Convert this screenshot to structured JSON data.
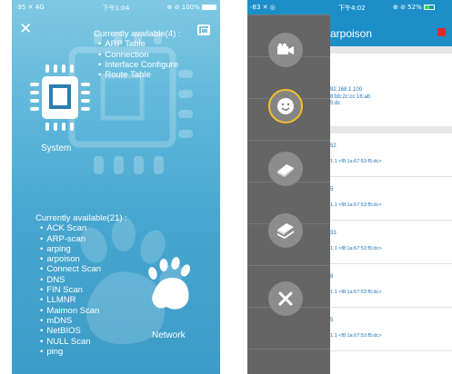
{
  "left_phone": {
    "status_bar": {
      "signal": "-95 ✕ 4G",
      "time": "下午1:04",
      "right": "⊕ ⊘ 100%"
    },
    "close_icon": "close-icon",
    "tab_icon": "window-icon",
    "system": {
      "label": "System",
      "header": "Currently available(4) :",
      "items": [
        "ARP Table",
        "Connection",
        "Interface Configure",
        "Route Table"
      ]
    },
    "network": {
      "label": "Network",
      "header": "Currently available(21) :",
      "items": [
        "ACK Scan",
        "ARP-scan",
        "arping",
        "arpoison",
        "Connect Scan",
        "DNS",
        "FIN Scan",
        "LLMNR",
        "Maimon Scan",
        "mDNS",
        "NetBIOS",
        "NULL Scan",
        "ping"
      ]
    }
  },
  "right_phone": {
    "status_bar": {
      "signal": "-83 ✕ ◎",
      "time": "下午4:02",
      "right": "⊕ ⊘ 52%"
    },
    "title": "arpoison",
    "info_lines": [
      "92.168.1.100",
      "8:bb:2c:cc:16:ab",
      "5:dc"
    ],
    "rows": [
      {
        "a": "52",
        "b": "1.1 <f8:1a:67:53:f5:dc>"
      },
      {
        "a": "5",
        "b": "1.1 <f8:1a:67:53:f5:dc>"
      },
      {
        "a": "33",
        "b": "1.1 <f8:1a:67:53:f5:dc>"
      },
      {
        "a": "8",
        "b": "1.1 <f8:1a:67:53:f5:dc>"
      },
      {
        "a": "5",
        "b": "1.1 <f8:1a:67:53:f5:dc>"
      }
    ],
    "drawer_buttons": [
      "camera-icon",
      "face-icon",
      "book-icon",
      "books-stack-icon",
      "close-icon"
    ],
    "colors": {
      "header": "#1c8fc9",
      "stop": "#e02b2b",
      "active_ring": "#f2c12e"
    }
  }
}
